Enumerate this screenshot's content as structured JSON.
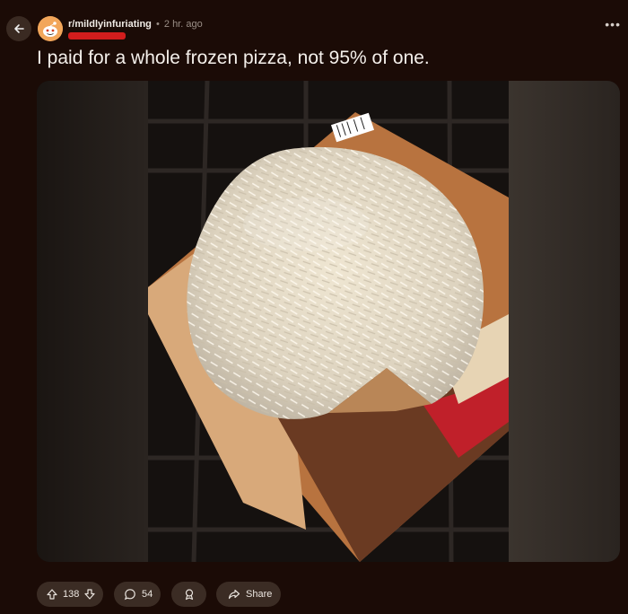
{
  "post": {
    "subreddit": "r/mildlyinfuriating",
    "separator": "•",
    "time": "2 hr. ago",
    "title": "I paid for a whole frozen pizza, not 95% of one."
  },
  "actions": {
    "upvotes": "138",
    "comments": "54",
    "share_label": "Share"
  },
  "colors": {
    "background": "#1b0b06",
    "pill": "#3b2c24",
    "redaction": "#d21d1d",
    "avatar": "#f2a65a"
  },
  "icons": [
    "back-arrow-icon",
    "subreddit-avatar-icon",
    "more-options-icon",
    "upvote-icon",
    "downvote-icon",
    "comment-icon",
    "award-icon",
    "share-icon"
  ]
}
